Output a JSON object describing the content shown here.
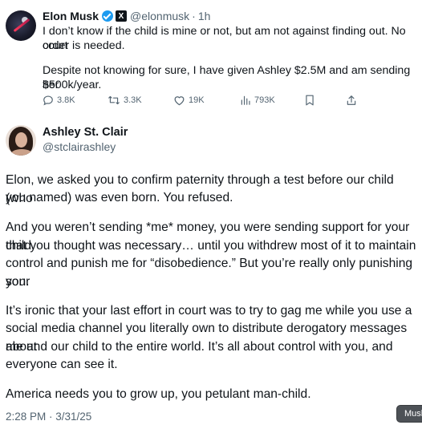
{
  "parent_tweet": {
    "author_name": "Elon Musk",
    "handle": "@elonmusk",
    "separator": "·",
    "time_ago": "1h",
    "x_badge": "X",
    "lines": [
      "I don’t know if the child is mine or not, but am not against finding out. No court",
      "order is needed.",
      "",
      "Despite not knowing for sure, I have given Ashley $2.5M and am sending her",
      "$500k/year."
    ],
    "stats": {
      "replies": "3.8K",
      "reposts": "3.3K",
      "likes": "19K",
      "views": "793K"
    },
    "icons": {
      "reply": "reply-icon",
      "repost": "repost-icon",
      "like": "heart-icon",
      "views": "views-icon",
      "bookmark": "bookmark-icon",
      "share": "share-icon",
      "verified": "verified-badge-icon"
    }
  },
  "main_tweet": {
    "author_name": "Ashley St. Clair",
    "handle": "@stclairashley",
    "lines": [
      "Elon, we asked you to confirm paternity through a test before our child (who",
      "you named) was even born. You refused.",
      "",
      "And you weren’t sending *me* money, you were sending support for your child",
      "that you thought was necessary… until you withdrew most of it to maintain",
      "control and punish me for “disobedience.” But you’re really only punishing your",
      "son.",
      "",
      "It’s ironic that your last effort in court was to try to gag me while you use a",
      "social media channel you literally own to distribute derogatory messages about",
      "me and our child to the entire world. It’s all about control with you, and",
      "everyone can see it.",
      "",
      "America needs you to grow up, you petulant man-child."
    ],
    "timestamp": "2:28 PM · 3/31/25"
  },
  "tooltip": {
    "text": "Musk"
  },
  "colors": {
    "text": "#0f1419",
    "secondary": "#536471",
    "verified_blue": "#1d9bf0",
    "tooltip_bg": "#4d5156"
  }
}
